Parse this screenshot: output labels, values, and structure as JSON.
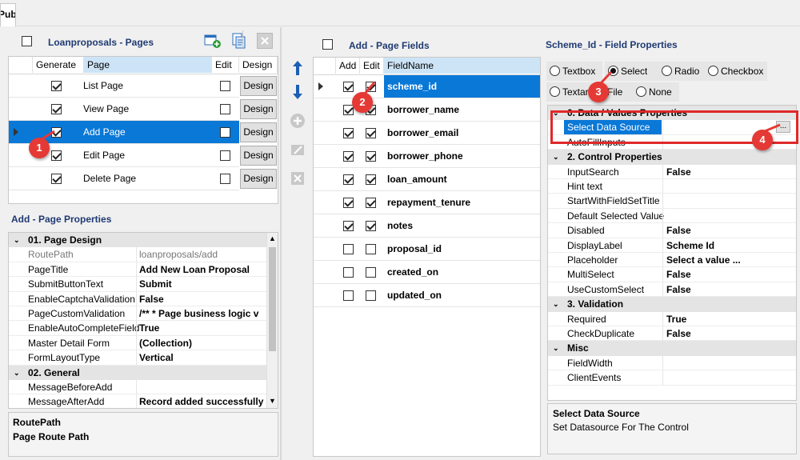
{
  "tab": {
    "label": "Publish"
  },
  "pages_panel": {
    "title": "Loanproposals - Pages",
    "columns": {
      "generate": "Generate",
      "page": "Page",
      "edit": "Edit",
      "design": "Design"
    },
    "rows": [
      {
        "page": "List Page",
        "generate": true,
        "edit": false,
        "design": "Design"
      },
      {
        "page": "View Page",
        "generate": true,
        "edit": false,
        "design": "Design"
      },
      {
        "page": "Add Page",
        "generate": true,
        "edit": false,
        "design": "Design"
      },
      {
        "page": "Edit Page",
        "generate": true,
        "edit": false,
        "design": "Design"
      },
      {
        "page": "Delete Page",
        "generate": true,
        "edit": false,
        "design": "Design"
      }
    ],
    "selected_index": 2
  },
  "page_props": {
    "title": "Add - Page Properties",
    "categories": [
      {
        "name": "01. Page Design",
        "rows": [
          {
            "k": "RoutePath",
            "v": "loanproposals/add",
            "dim": true
          },
          {
            "k": "PageTitle",
            "v": "Add New Loan Proposal"
          },
          {
            "k": "SubmitButtonText",
            "v": "Submit"
          },
          {
            "k": "EnableCaptchaValidation",
            "v": "False"
          },
          {
            "k": "PageCustomValidation",
            "v": "     /**     * Page business logic v"
          },
          {
            "k": "EnableAutoCompleteField",
            "v": "True"
          },
          {
            "k": "Master Detail Form",
            "v": "(Collection)"
          },
          {
            "k": "FormLayoutType",
            "v": "Vertical"
          }
        ]
      },
      {
        "name": "02. General",
        "rows": [
          {
            "k": "MessageBeforeAdd",
            "v": ""
          },
          {
            "k": "MessageAfterAdd",
            "v": "Record added successfully"
          }
        ]
      }
    ],
    "help_title": "RoutePath",
    "help_text": "Page Route Path"
  },
  "fields_panel": {
    "title": "Add - Page Fields",
    "columns": {
      "add": "Add",
      "edit": "Edit",
      "field": "FieldName"
    },
    "rows": [
      {
        "field": "scheme_id",
        "add": true,
        "edit": true
      },
      {
        "field": "borrower_name",
        "add": true,
        "edit": true
      },
      {
        "field": "borrower_email",
        "add": true,
        "edit": true
      },
      {
        "field": "borrower_phone",
        "add": true,
        "edit": true
      },
      {
        "field": "loan_amount",
        "add": true,
        "edit": true
      },
      {
        "field": "repayment_tenure",
        "add": true,
        "edit": true
      },
      {
        "field": "notes",
        "add": true,
        "edit": true
      },
      {
        "field": "proposal_id",
        "add": false,
        "edit": false
      },
      {
        "field": "created_on",
        "add": false,
        "edit": false
      },
      {
        "field": "updated_on",
        "add": false,
        "edit": false
      }
    ],
    "selected_index": 0
  },
  "field_props": {
    "title": "Scheme_Id - Field Properties",
    "control_types": [
      {
        "label": "Textbox",
        "on": false
      },
      {
        "label": "Select",
        "on": true
      },
      {
        "label": "Radio",
        "on": false
      },
      {
        "label": "Checkbox",
        "on": false
      },
      {
        "label": "Textarea",
        "on": false
      },
      {
        "label": "File",
        "on": false
      },
      {
        "label": "None",
        "on": false
      }
    ],
    "categories": [
      {
        "name": "0. Data / Values Properties",
        "rows": [
          {
            "k": "Select Data Source",
            "v": "",
            "selected": true,
            "ellipsis": "..."
          },
          {
            "k": "AutoFillInputs",
            "v": ""
          }
        ]
      },
      {
        "name": "2. Control Properties",
        "rows": [
          {
            "k": "InputSearch",
            "v": "False"
          },
          {
            "k": "Hint text",
            "v": ""
          },
          {
            "k": "StartWithFieldSetTitle",
            "v": ""
          },
          {
            "k": "Default Selected Value",
            "v": ""
          },
          {
            "k": "Disabled",
            "v": "False"
          },
          {
            "k": "DisplayLabel",
            "v": "Scheme Id"
          },
          {
            "k": "Placeholder",
            "v": "Select a value ..."
          },
          {
            "k": "MultiSelect",
            "v": "False"
          },
          {
            "k": "UseCustomSelect",
            "v": "False"
          }
        ]
      },
      {
        "name": "3. Validation",
        "rows": [
          {
            "k": "Required",
            "v": "True"
          },
          {
            "k": "CheckDuplicate",
            "v": "False"
          }
        ]
      },
      {
        "name": "Misc",
        "rows": [
          {
            "k": "FieldWidth",
            "v": ""
          },
          {
            "k": "ClientEvents",
            "v": ""
          }
        ]
      }
    ],
    "help_title": "Select Data Source",
    "help_text": "Set Datasource For The Control"
  },
  "badges": [
    "1",
    "2",
    "3",
    "4"
  ],
  "colors": {
    "selection": "#0a78d7",
    "title": "#1f3a72",
    "badge": "#e53935",
    "arrow": "#1a5fb4"
  }
}
